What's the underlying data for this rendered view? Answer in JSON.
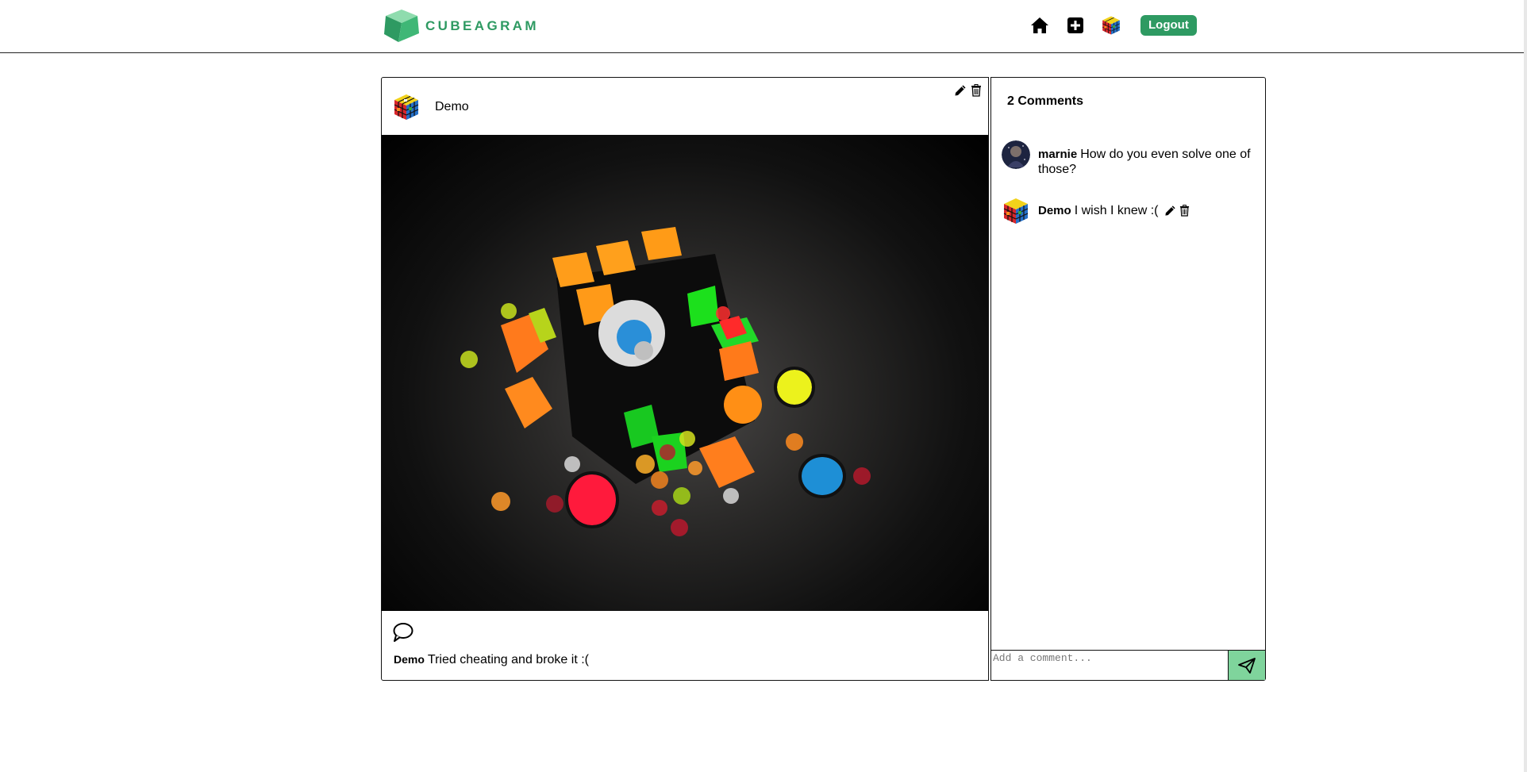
{
  "brand": {
    "name": "CUBEAGRAM"
  },
  "nav": {
    "home_icon": "home-icon",
    "create_icon": "plus-square-icon",
    "profile_icon": "rubiks-cube-avatar",
    "logout_label": "Logout"
  },
  "colors": {
    "accent": "#2e9a62",
    "send_button": "#7fd49c"
  },
  "post": {
    "username": "Demo",
    "caption_author": "Demo",
    "caption_text": "Tried cheating and broke it :("
  },
  "comments": {
    "count_label": "2 Comments",
    "items": [
      {
        "author": "marnie",
        "text": "How do you even solve one of those?"
      },
      {
        "author": "Demo",
        "text": "I wish I knew :("
      }
    ],
    "input_placeholder": "Add a comment..."
  }
}
